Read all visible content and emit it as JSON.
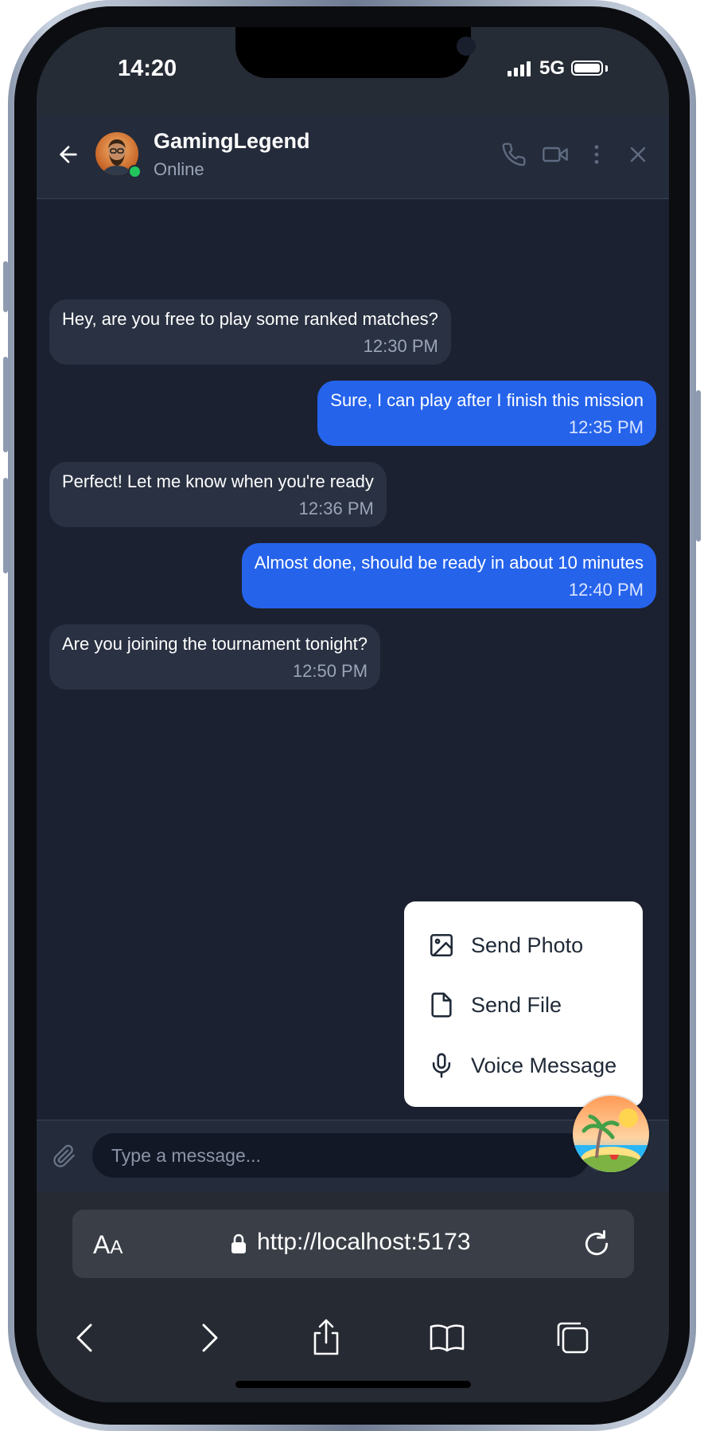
{
  "status_bar": {
    "time": "14:20",
    "network": "5G"
  },
  "header": {
    "contact_name": "GamingLegend",
    "contact_status": "Online",
    "icons": [
      "back-arrow-icon",
      "phone-icon",
      "video-icon",
      "more-vertical-icon",
      "close-icon"
    ]
  },
  "messages": [
    {
      "direction": "incoming",
      "text": "Hey, are you free to play some ranked matches?",
      "time": "12:30 PM"
    },
    {
      "direction": "outgoing",
      "text": "Sure, I can play after I finish this mission",
      "time": "12:35 PM"
    },
    {
      "direction": "incoming",
      "text": "Perfect! Let me know when you're ready",
      "time": "12:36 PM"
    },
    {
      "direction": "outgoing",
      "text": "Almost done, should be ready in about 10 minutes",
      "time": "12:40 PM"
    },
    {
      "direction": "incoming",
      "text": "Are you joining the tournament tonight?",
      "time": "12:50 PM"
    }
  ],
  "attach_menu": {
    "items": [
      {
        "label": "Send Photo",
        "icon": "image-icon"
      },
      {
        "label": "Send File",
        "icon": "file-icon"
      },
      {
        "label": "Voice Message",
        "icon": "microphone-icon"
      }
    ]
  },
  "composer": {
    "placeholder": "Type a message..."
  },
  "browser": {
    "text_size_label": "AA",
    "url": "http://localhost:5173"
  },
  "colors": {
    "accent": "#2563eb",
    "online": "#22c55e",
    "incoming_bubble": "#293142",
    "chat_background": "#1b2130"
  }
}
